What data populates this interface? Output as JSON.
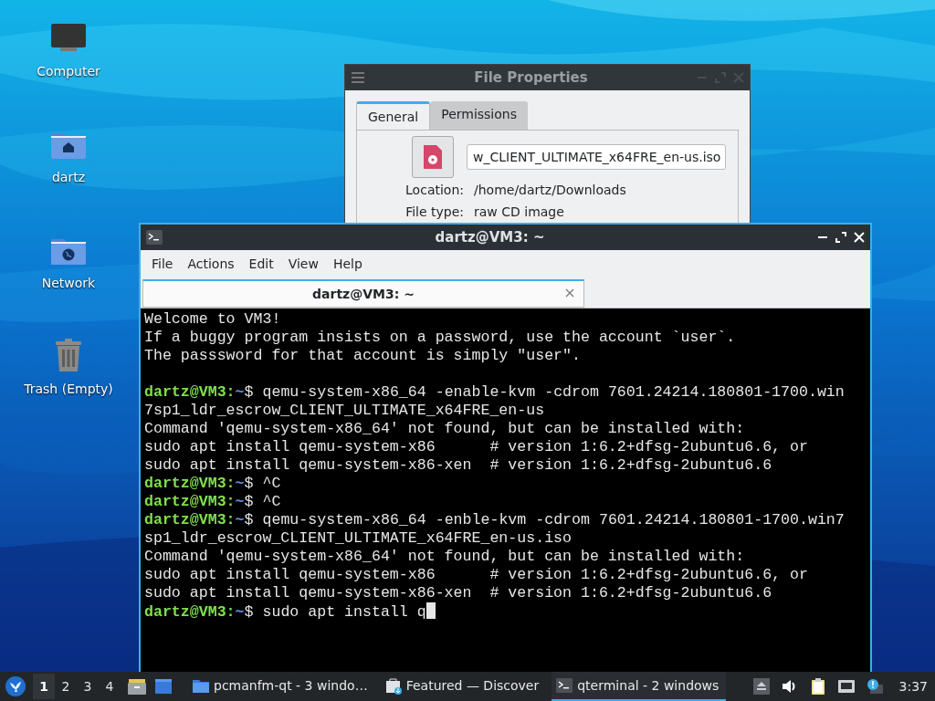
{
  "desktop": {
    "icons": [
      {
        "label": "Computer",
        "kind": "computer"
      },
      {
        "label": "dartz",
        "kind": "home"
      },
      {
        "label": "Network",
        "kind": "network"
      },
      {
        "label": "Trash (Empty)",
        "kind": "trash"
      }
    ]
  },
  "file_properties": {
    "title": "File Properties",
    "tabs": [
      {
        "label": "General",
        "selected": true
      },
      {
        "label": "Permissions",
        "selected": false
      }
    ],
    "file_name": "w_CLIENT_ULTIMATE_x64FRE_en-us.iso",
    "fields": [
      {
        "label": "Location:",
        "value": "/home/dartz/Downloads"
      },
      {
        "label": "File type:",
        "value": "raw CD image"
      }
    ]
  },
  "terminal": {
    "title": "dartz@VM3: ~",
    "menu": [
      "File",
      "Actions",
      "Edit",
      "View",
      "Help"
    ],
    "tabs": [
      {
        "label": "dartz@VM3: ~",
        "selected": true
      }
    ],
    "lines": [
      {
        "kind": "text",
        "text": "Welcome to VM3!"
      },
      {
        "kind": "text",
        "text": "If a buggy program insists on a password, use the account `user`."
      },
      {
        "kind": "text",
        "text": "The passsword for that account is simply \"user\"."
      },
      {
        "kind": "blank"
      },
      {
        "kind": "prompt",
        "user": "dartz@VM3:",
        "path": "~",
        "sign": "$",
        "command": "qemu-system-x86_64 -enable-kvm -cdrom 7601.24214.180801-1700.win"
      },
      {
        "kind": "text",
        "text": "7sp1_ldr_escrow_CLIENT_ULTIMATE_x64FRE_en-us"
      },
      {
        "kind": "text",
        "text": "Command 'qemu-system-x86_64' not found, but can be installed with:"
      },
      {
        "kind": "text",
        "text": "sudo apt install qemu-system-x86      # version 1:6.2+dfsg-2ubuntu6.6, or"
      },
      {
        "kind": "text",
        "text": "sudo apt install qemu-system-x86-xen  # version 1:6.2+dfsg-2ubuntu6.6"
      },
      {
        "kind": "prompt",
        "user": "dartz@VM3:",
        "path": "~",
        "sign": "$",
        "command": "^C"
      },
      {
        "kind": "prompt",
        "user": "dartz@VM3:",
        "path": "~",
        "sign": "$",
        "command": "^C"
      },
      {
        "kind": "prompt",
        "user": "dartz@VM3:",
        "path": "~",
        "sign": "$",
        "command": "qemu-system-x86_64 -enble-kvm -cdrom 7601.24214.180801-1700.win7"
      },
      {
        "kind": "text",
        "text": "sp1_ldr_escrow_CLIENT_ULTIMATE_x64FRE_en-us.iso"
      },
      {
        "kind": "text",
        "text": "Command 'qemu-system-x86_64' not found, but can be installed with:"
      },
      {
        "kind": "text",
        "text": "sudo apt install qemu-system-x86      # version 1:6.2+dfsg-2ubuntu6.6, or"
      },
      {
        "kind": "text",
        "text": "sudo apt install qemu-system-x86-xen  # version 1:6.2+dfsg-2ubuntu6.6"
      },
      {
        "kind": "prompt",
        "user": "dartz@VM3:",
        "path": "~",
        "sign": "$",
        "command": "sudo apt install q",
        "cursor": true
      }
    ]
  },
  "taskbar": {
    "desktops": [
      {
        "label": "1",
        "selected": true
      },
      {
        "label": "2",
        "selected": false
      },
      {
        "label": "3",
        "selected": false
      },
      {
        "label": "4",
        "selected": false
      }
    ],
    "tasks": [
      {
        "label": "pcmanfm-qt - 3 windo…",
        "kind": "folder",
        "selected": false
      },
      {
        "label": "Featured — Discover",
        "kind": "store",
        "selected": false
      },
      {
        "label": "qterminal - 2 windows",
        "kind": "terminal",
        "selected": true
      }
    ],
    "clock": "3:37"
  }
}
